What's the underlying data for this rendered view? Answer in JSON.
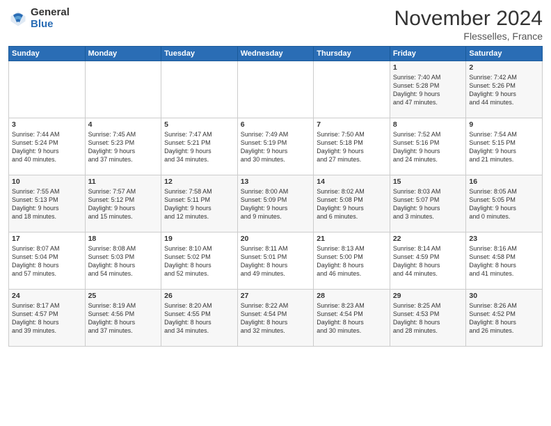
{
  "logo": {
    "general": "General",
    "blue": "Blue"
  },
  "header": {
    "month": "November 2024",
    "location": "Flesselles, France"
  },
  "days_of_week": [
    "Sunday",
    "Monday",
    "Tuesday",
    "Wednesday",
    "Thursday",
    "Friday",
    "Saturday"
  ],
  "weeks": [
    [
      {
        "day": "",
        "info": ""
      },
      {
        "day": "",
        "info": ""
      },
      {
        "day": "",
        "info": ""
      },
      {
        "day": "",
        "info": ""
      },
      {
        "day": "",
        "info": ""
      },
      {
        "day": "1",
        "info": "Sunrise: 7:40 AM\nSunset: 5:28 PM\nDaylight: 9 hours\nand 47 minutes."
      },
      {
        "day": "2",
        "info": "Sunrise: 7:42 AM\nSunset: 5:26 PM\nDaylight: 9 hours\nand 44 minutes."
      }
    ],
    [
      {
        "day": "3",
        "info": "Sunrise: 7:44 AM\nSunset: 5:24 PM\nDaylight: 9 hours\nand 40 minutes."
      },
      {
        "day": "4",
        "info": "Sunrise: 7:45 AM\nSunset: 5:23 PM\nDaylight: 9 hours\nand 37 minutes."
      },
      {
        "day": "5",
        "info": "Sunrise: 7:47 AM\nSunset: 5:21 PM\nDaylight: 9 hours\nand 34 minutes."
      },
      {
        "day": "6",
        "info": "Sunrise: 7:49 AM\nSunset: 5:19 PM\nDaylight: 9 hours\nand 30 minutes."
      },
      {
        "day": "7",
        "info": "Sunrise: 7:50 AM\nSunset: 5:18 PM\nDaylight: 9 hours\nand 27 minutes."
      },
      {
        "day": "8",
        "info": "Sunrise: 7:52 AM\nSunset: 5:16 PM\nDaylight: 9 hours\nand 24 minutes."
      },
      {
        "day": "9",
        "info": "Sunrise: 7:54 AM\nSunset: 5:15 PM\nDaylight: 9 hours\nand 21 minutes."
      }
    ],
    [
      {
        "day": "10",
        "info": "Sunrise: 7:55 AM\nSunset: 5:13 PM\nDaylight: 9 hours\nand 18 minutes."
      },
      {
        "day": "11",
        "info": "Sunrise: 7:57 AM\nSunset: 5:12 PM\nDaylight: 9 hours\nand 15 minutes."
      },
      {
        "day": "12",
        "info": "Sunrise: 7:58 AM\nSunset: 5:11 PM\nDaylight: 9 hours\nand 12 minutes."
      },
      {
        "day": "13",
        "info": "Sunrise: 8:00 AM\nSunset: 5:09 PM\nDaylight: 9 hours\nand 9 minutes."
      },
      {
        "day": "14",
        "info": "Sunrise: 8:02 AM\nSunset: 5:08 PM\nDaylight: 9 hours\nand 6 minutes."
      },
      {
        "day": "15",
        "info": "Sunrise: 8:03 AM\nSunset: 5:07 PM\nDaylight: 9 hours\nand 3 minutes."
      },
      {
        "day": "16",
        "info": "Sunrise: 8:05 AM\nSunset: 5:05 PM\nDaylight: 9 hours\nand 0 minutes."
      }
    ],
    [
      {
        "day": "17",
        "info": "Sunrise: 8:07 AM\nSunset: 5:04 PM\nDaylight: 8 hours\nand 57 minutes."
      },
      {
        "day": "18",
        "info": "Sunrise: 8:08 AM\nSunset: 5:03 PM\nDaylight: 8 hours\nand 54 minutes."
      },
      {
        "day": "19",
        "info": "Sunrise: 8:10 AM\nSunset: 5:02 PM\nDaylight: 8 hours\nand 52 minutes."
      },
      {
        "day": "20",
        "info": "Sunrise: 8:11 AM\nSunset: 5:01 PM\nDaylight: 8 hours\nand 49 minutes."
      },
      {
        "day": "21",
        "info": "Sunrise: 8:13 AM\nSunset: 5:00 PM\nDaylight: 8 hours\nand 46 minutes."
      },
      {
        "day": "22",
        "info": "Sunrise: 8:14 AM\nSunset: 4:59 PM\nDaylight: 8 hours\nand 44 minutes."
      },
      {
        "day": "23",
        "info": "Sunrise: 8:16 AM\nSunset: 4:58 PM\nDaylight: 8 hours\nand 41 minutes."
      }
    ],
    [
      {
        "day": "24",
        "info": "Sunrise: 8:17 AM\nSunset: 4:57 PM\nDaylight: 8 hours\nand 39 minutes."
      },
      {
        "day": "25",
        "info": "Sunrise: 8:19 AM\nSunset: 4:56 PM\nDaylight: 8 hours\nand 37 minutes."
      },
      {
        "day": "26",
        "info": "Sunrise: 8:20 AM\nSunset: 4:55 PM\nDaylight: 8 hours\nand 34 minutes."
      },
      {
        "day": "27",
        "info": "Sunrise: 8:22 AM\nSunset: 4:54 PM\nDaylight: 8 hours\nand 32 minutes."
      },
      {
        "day": "28",
        "info": "Sunrise: 8:23 AM\nSunset: 4:54 PM\nDaylight: 8 hours\nand 30 minutes."
      },
      {
        "day": "29",
        "info": "Sunrise: 8:25 AM\nSunset: 4:53 PM\nDaylight: 8 hours\nand 28 minutes."
      },
      {
        "day": "30",
        "info": "Sunrise: 8:26 AM\nSunset: 4:52 PM\nDaylight: 8 hours\nand 26 minutes."
      }
    ]
  ]
}
